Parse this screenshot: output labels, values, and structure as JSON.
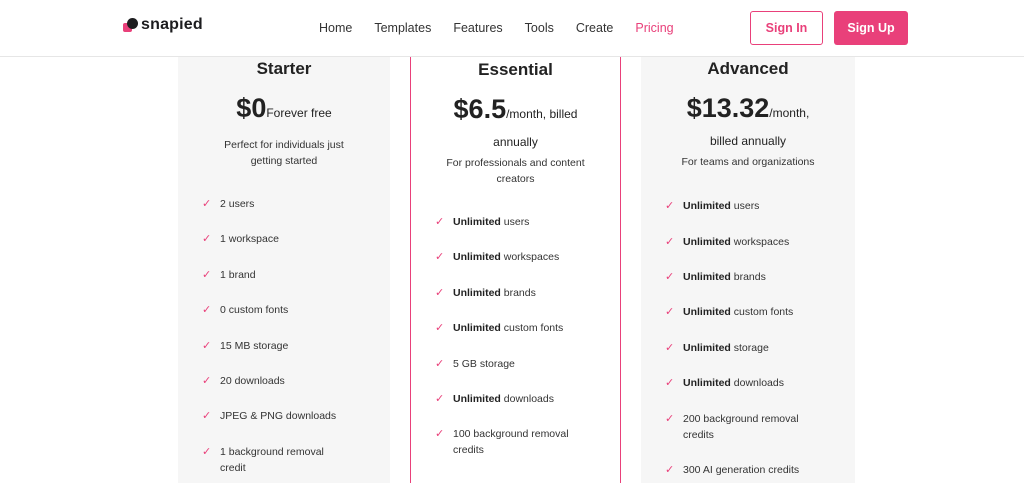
{
  "brand": {
    "name": "snapied"
  },
  "nav": {
    "items": [
      "Home",
      "Templates",
      "Features",
      "Tools",
      "Create",
      "Pricing"
    ],
    "active": "Pricing"
  },
  "auth": {
    "sign_in": "Sign In",
    "sign_up": "Sign Up"
  },
  "colors": {
    "accent": "#e9407a",
    "card_bg": "#f6f6f6"
  },
  "plans": [
    {
      "name": "Starter",
      "price": "$0",
      "period": "Forever free",
      "period_cont": "",
      "description": "Perfect for individuals just getting started",
      "features": [
        {
          "bold": "",
          "text": "2 users"
        },
        {
          "bold": "",
          "text": "1 workspace"
        },
        {
          "bold": "",
          "text": "1 brand"
        },
        {
          "bold": "",
          "text": "0 custom fonts"
        },
        {
          "bold": "",
          "text": "15 MB storage"
        },
        {
          "bold": "",
          "text": "20 downloads"
        },
        {
          "bold": "",
          "text": "JPEG & PNG downloads"
        },
        {
          "bold": "",
          "text": "1 background removal credit"
        }
      ]
    },
    {
      "name": "Essential",
      "price": "$6.5",
      "period": "/month, billed",
      "period_cont": "annually",
      "description": "For professionals and content creators",
      "features": [
        {
          "bold": "Unlimited",
          "text": " users"
        },
        {
          "bold": "Unlimited",
          "text": " workspaces"
        },
        {
          "bold": "Unlimited",
          "text": " brands"
        },
        {
          "bold": "Unlimited",
          "text": " custom fonts"
        },
        {
          "bold": "",
          "text": "5 GB storage"
        },
        {
          "bold": "Unlimited",
          "text": " downloads"
        },
        {
          "bold": "",
          "text": "100 background removal credits"
        }
      ]
    },
    {
      "name": "Advanced",
      "price": "$13.32",
      "period": "/month,",
      "period_cont": "billed annually",
      "description": "For teams and organizations",
      "features": [
        {
          "bold": "Unlimited",
          "text": " users"
        },
        {
          "bold": "Unlimited",
          "text": " workspaces"
        },
        {
          "bold": "Unlimited",
          "text": " brands"
        },
        {
          "bold": "Unlimited",
          "text": " custom fonts"
        },
        {
          "bold": "Unlimited",
          "text": " storage"
        },
        {
          "bold": "Unlimited",
          "text": " downloads"
        },
        {
          "bold": "",
          "text": "200 background removal credits"
        },
        {
          "bold": "",
          "text": "300 AI generation credits"
        }
      ]
    }
  ]
}
